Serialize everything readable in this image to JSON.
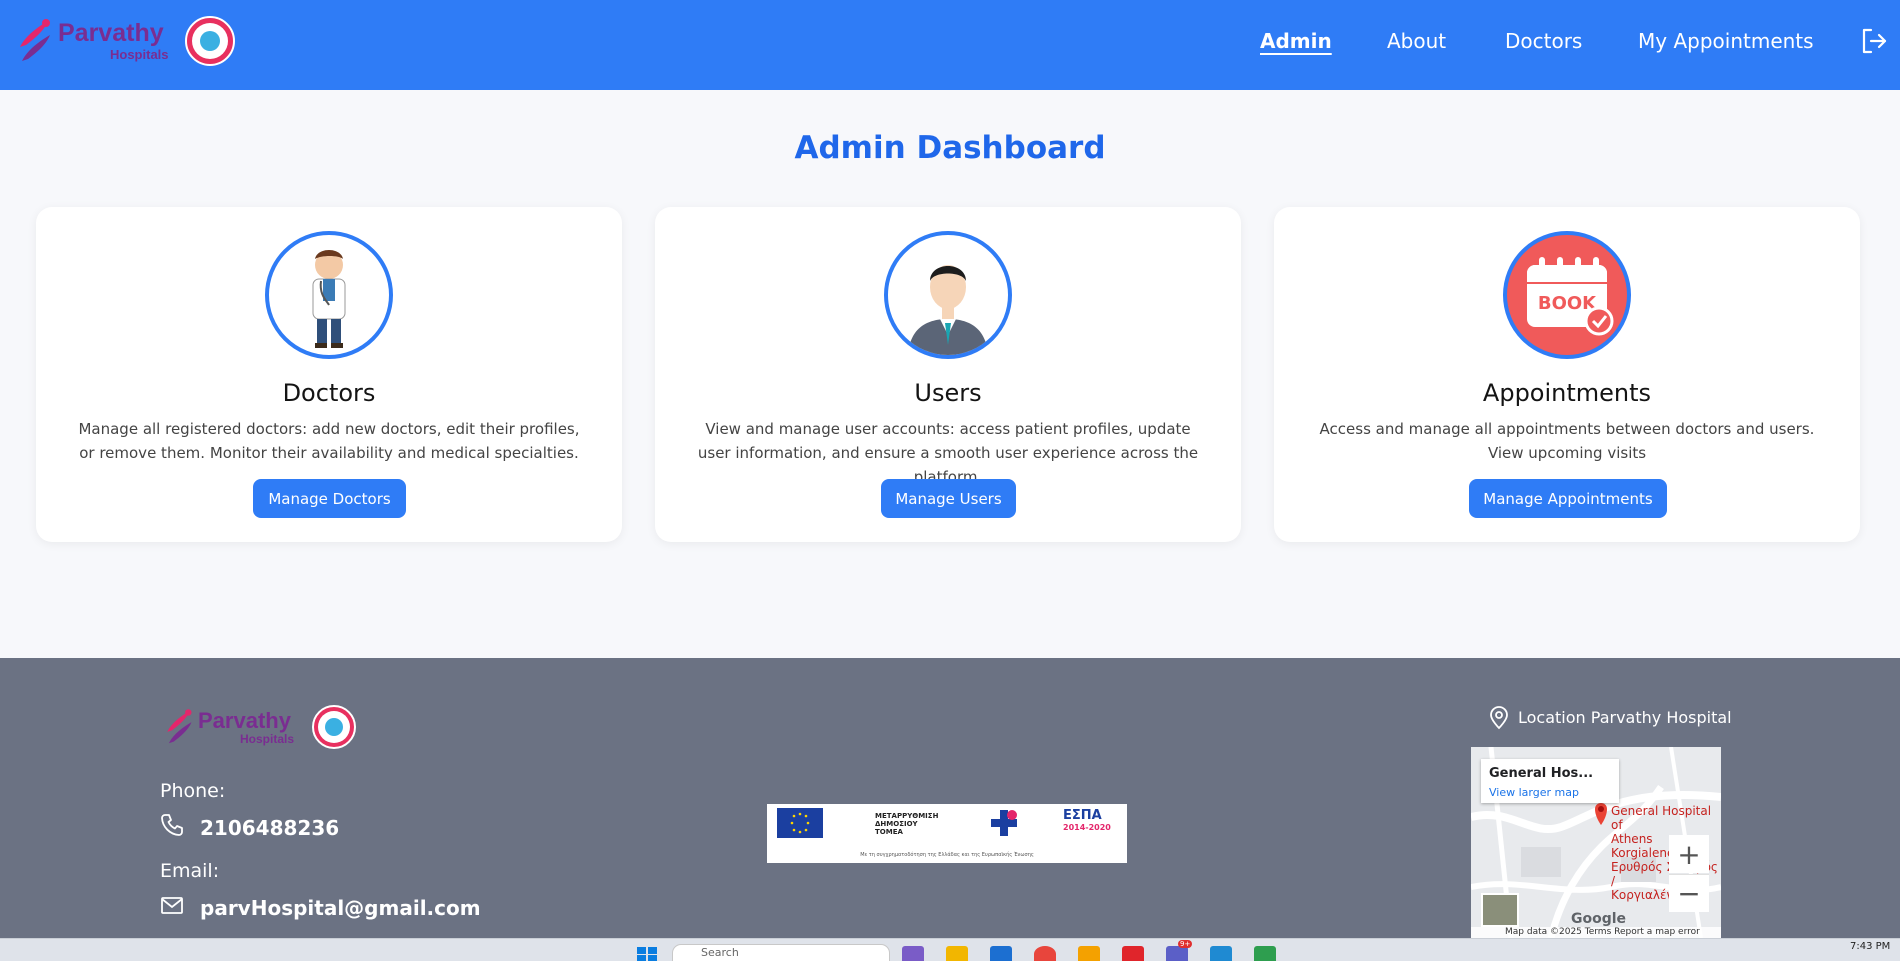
{
  "brand": {
    "name": "Parvathy",
    "sub": "Hospitals"
  },
  "nav": {
    "items": [
      {
        "label": "Admin",
        "active": true
      },
      {
        "label": "About",
        "active": false
      },
      {
        "label": "Doctors",
        "active": false
      },
      {
        "label": "My Appointments",
        "active": false
      }
    ],
    "logout_icon": "logout-icon"
  },
  "page": {
    "title": "Admin Dashboard"
  },
  "cards": [
    {
      "title": "Doctors",
      "description": "Manage all registered doctors: add new doctors, edit their profiles, or remove them. Monitor their availability and medical specialties.",
      "button": "Manage Doctors",
      "icon": "doctor-illustration"
    },
    {
      "title": "Users",
      "description": "View and manage user accounts: access patient profiles, update user information, and ensure a smooth user experience across the platform.",
      "button": "Manage Users",
      "icon": "user-avatar-icon"
    },
    {
      "title": "Appointments",
      "description": "Access and manage all appointments between doctors and users. View upcoming visits",
      "button": "Manage Appointments",
      "icon": "book-calendar-icon",
      "icon_text": "BOOK"
    }
  ],
  "footer": {
    "phone_label": "Phone:",
    "phone": "2106488236",
    "email_label": "Email:",
    "email": "parvHospital@gmail.com",
    "location_label": "Location Parvathy Hospital",
    "banner": {
      "items": [
        "ΜΕΤΑΡΡΥΘΜΙΣΗ ΔΗΜΟΣΙΟΥ ΤΟΜΕΑ",
        "ΕΣΠΑ",
        "2014-2020"
      ],
      "caption": "Με τη συγχρηματοδότηση της Ελλάδας και της Ευρωπαϊκής Ένωσης"
    },
    "map": {
      "card_title": "General Hos...",
      "card_link": "View larger map",
      "place_line1": "General Hospital of",
      "place_line2": "Athens Korgialenei",
      "place_line3": "Ερυθρός Σταυρός /",
      "place_line4": "Κοργιαλένειο",
      "zoom_in": "+",
      "zoom_out": "−",
      "provider": "Google",
      "attribution": "Map data ©2025   Terms   Report a map error"
    }
  },
  "taskbar": {
    "search_placeholder": "Search",
    "time": "7:43 PM",
    "badge": "9+"
  },
  "colors": {
    "primary": "#2f7cf6",
    "title": "#1f67ea",
    "footer": "#6b7283",
    "brand": "#7a2d91"
  }
}
